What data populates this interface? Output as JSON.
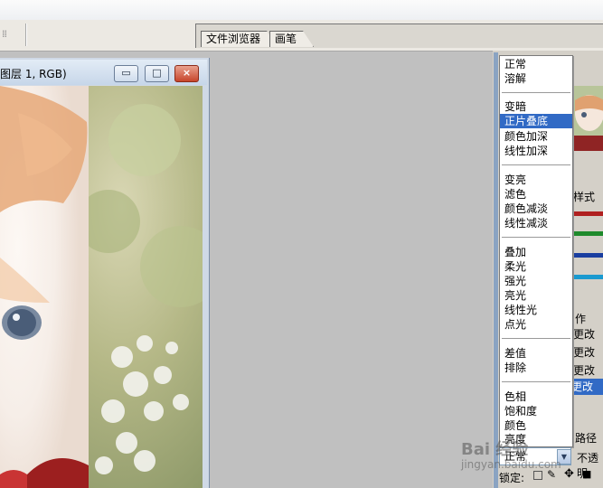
{
  "toolbar": {
    "grip": "⁞⁞",
    "well_tabs": [
      "文件浏览器",
      "画笔"
    ]
  },
  "document": {
    "title": "图层 1, RGB)",
    "buttons": {
      "minimize": "▭",
      "maximize": "□",
      "close": "×"
    }
  },
  "right_panel": {
    "style_tab": "样式",
    "actions_tab": "作",
    "history_items": [
      "更改",
      "更改",
      "更改",
      "更改"
    ],
    "paths_tab": "路径",
    "opacity_label": "不透明",
    "lock_label": "锁定:"
  },
  "blend_mode_dropdown": {
    "groups": [
      [
        "正常",
        "溶解"
      ],
      [
        "变暗",
        "正片叠底",
        "颜色加深",
        "线性加深"
      ],
      [
        "变亮",
        "滤色",
        "颜色减淡",
        "线性减淡"
      ],
      [
        "叠加",
        "柔光",
        "强光",
        "亮光",
        "线性光",
        "点光"
      ],
      [
        "差值",
        "排除"
      ],
      [
        "色相",
        "饱和度",
        "颜色",
        "亮度"
      ]
    ],
    "selected": "正片叠底",
    "current_value": "正常"
  },
  "watermark": {
    "text": "Bai 经验",
    "sub": "jingyan.baidu.com"
  },
  "colors": {
    "selection": "#316ac5",
    "title_bar": "#c6d6e9"
  }
}
